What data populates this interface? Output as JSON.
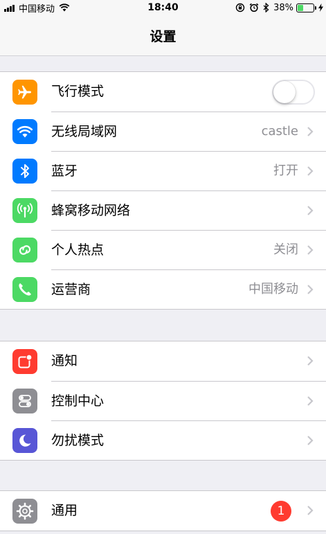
{
  "status_bar": {
    "carrier": "中国移动",
    "time": "18:40",
    "battery_percent": "38%",
    "battery_level": 0.38
  },
  "nav": {
    "title": "设置"
  },
  "groups": [
    {
      "rows": [
        {
          "label": "飞行模式",
          "icon": "airplane-icon",
          "icon_color": "#ff9500",
          "toggle": true,
          "toggle_on": false
        },
        {
          "label": "无线局域网",
          "icon": "wifi-icon",
          "icon_color": "#007aff",
          "value": "castle"
        },
        {
          "label": "蓝牙",
          "icon": "bluetooth-icon",
          "icon_color": "#007aff",
          "value": "打开"
        },
        {
          "label": "蜂窝移动网络",
          "icon": "cellular-icon",
          "icon_color": "#4cd964"
        },
        {
          "label": "个人热点",
          "icon": "hotspot-icon",
          "icon_color": "#4cd964",
          "value": "关闭"
        },
        {
          "label": "运营商",
          "icon": "phone-icon",
          "icon_color": "#4cd964",
          "value": "中国移动"
        }
      ]
    },
    {
      "rows": [
        {
          "label": "通知",
          "icon": "notifications-icon",
          "icon_color": "#ff3b30"
        },
        {
          "label": "控制中心",
          "icon": "control-center-icon",
          "icon_color": "#8e8e93"
        },
        {
          "label": "勿扰模式",
          "icon": "moon-icon",
          "icon_color": "#5856d6"
        }
      ]
    },
    {
      "rows": [
        {
          "label": "通用",
          "icon": "gear-icon",
          "icon_color": "#8e8e93",
          "badge": "1"
        }
      ]
    }
  ]
}
